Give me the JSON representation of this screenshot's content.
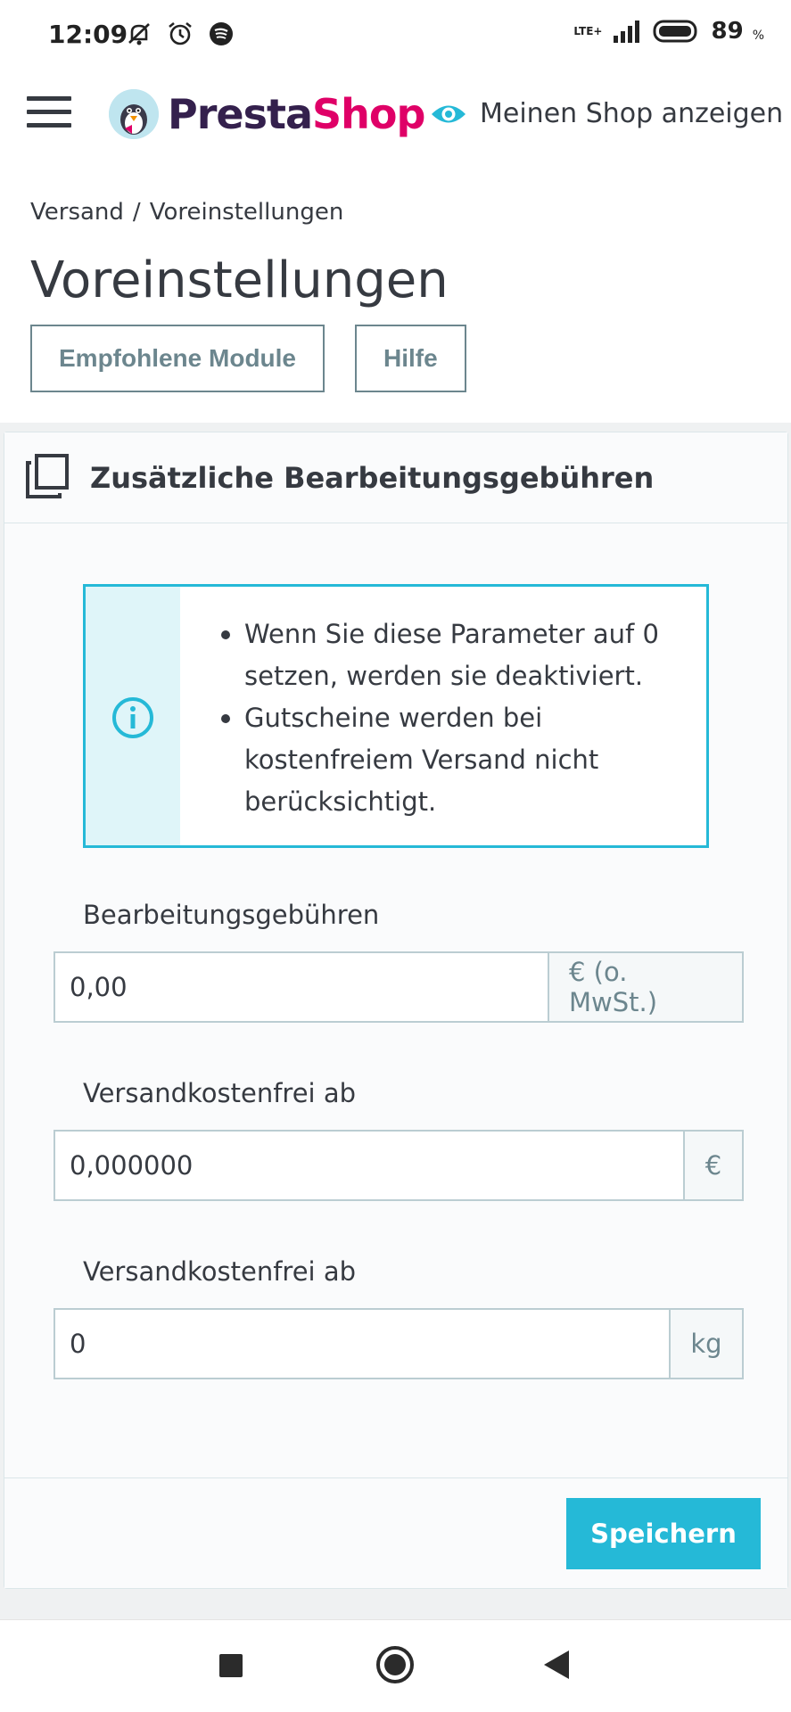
{
  "status_bar": {
    "time": "12:09",
    "network": "LTE+",
    "battery": "89",
    "battery_unit": "%"
  },
  "header": {
    "logo_part1": "Presta",
    "logo_part2": "Shop",
    "view_shop_label": "Meinen Shop anzeigen"
  },
  "breadcrumb": {
    "items": [
      "Versand",
      "Voreinstellungen"
    ],
    "separator": "/"
  },
  "page_title": "Voreinstellungen",
  "toolbar": {
    "recommended_modules": "Empfohlene Module",
    "help": "Hilfe"
  },
  "panel": {
    "title": "Zusätzliche Bearbeitungsgebühren",
    "alert_items": [
      "Wenn Sie diese Parameter auf 0 setzen, werden sie deaktiviert.",
      "Gutscheine werden bei kostenfreiem Versand nicht berücksichtigt."
    ],
    "fields": [
      {
        "label": "Bearbeitungsgebühren",
        "value": "0,00",
        "addon": "€ (o. MwSt.)"
      },
      {
        "label": "Versandkostenfrei ab",
        "value": "0,000000",
        "addon": "€"
      },
      {
        "label": "Versandkostenfrei ab",
        "value": "0",
        "addon": "kg"
      }
    ],
    "save_label": "Speichern"
  },
  "colors": {
    "primary": "#25b9d7",
    "text": "#363a41",
    "muted": "#6c868e",
    "brand_dark": "#34204d",
    "brand_pink": "#df0067"
  },
  "icons": {
    "menu": "hamburger-icon",
    "view_shop": "eye-icon",
    "panel": "copy-icon",
    "alert": "info-icon"
  }
}
